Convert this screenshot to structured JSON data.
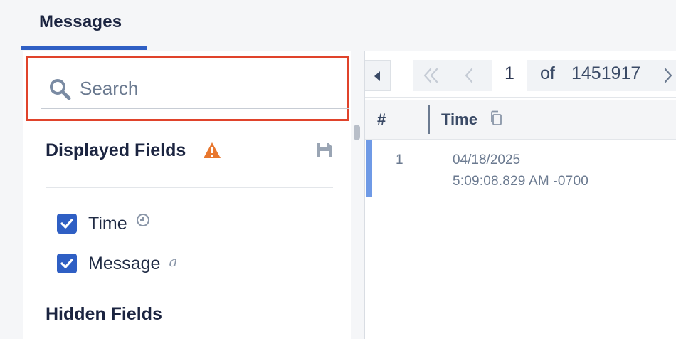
{
  "tabs": [
    {
      "label": "Messages",
      "active": true
    }
  ],
  "search": {
    "placeholder": "Search",
    "value": ""
  },
  "fields_panel": {
    "displayed_title": "Displayed Fields",
    "hidden_title": "Hidden Fields",
    "displayed_fields": [
      {
        "label": "Time",
        "checked": true,
        "type_icon": "clock-icon"
      },
      {
        "label": "Message",
        "checked": true,
        "type_indicator": "a"
      }
    ]
  },
  "pager": {
    "current_page": "1",
    "of_label": "of",
    "total_pages": "1451917"
  },
  "table": {
    "columns": [
      {
        "label": "#"
      },
      {
        "label": "Time"
      }
    ],
    "rows": [
      {
        "index": "1",
        "date": "04/18/2025",
        "time": "5:09:08.829 AM -0700"
      }
    ]
  },
  "colors": {
    "accent": "#2f5fc4",
    "highlight_border": "#e0432b",
    "warning": "#e8772e",
    "row_marker": "#6f9ae6"
  }
}
